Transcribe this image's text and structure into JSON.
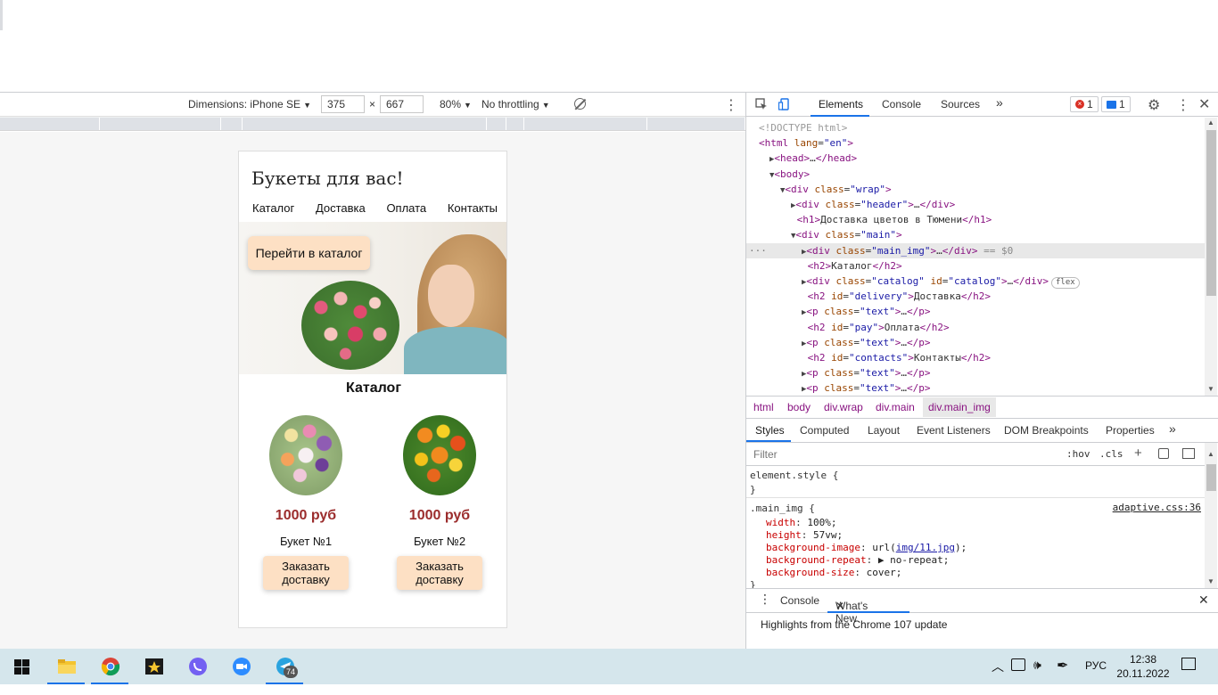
{
  "device_toolbar": {
    "dimensions_label": "Dimensions: iPhone SE",
    "width": "375",
    "times": "×",
    "height": "667",
    "zoom": "80%",
    "throttling": "No throttling"
  },
  "site": {
    "title": "Букеты для вас!",
    "nav": [
      "Каталог",
      "Доставка",
      "Оплата",
      "Контакты"
    ],
    "hero_button": "Перейти в каталог",
    "catalog_heading": "Каталог",
    "products": [
      {
        "price": "1000 руб",
        "name": "Букет №1",
        "button": "Заказать доставку"
      },
      {
        "price": "1000 руб",
        "name": "Букет №2",
        "button": "Заказать доставку"
      }
    ]
  },
  "devtools": {
    "tabs": [
      "Elements",
      "Console",
      "Sources"
    ],
    "more": "»",
    "error_count": "1",
    "message_count": "1",
    "dom_lines": [
      {
        "indent": 0,
        "html": "<span class='comment'>&lt;!DOCTYPE html&gt;</span>"
      },
      {
        "indent": 0,
        "html": "<span class='tag'>&lt;html</span> <span class='attr'>lang</span>=<span class='val'>\"en\"</span><span class='tag'>&gt;</span>"
      },
      {
        "indent": 1,
        "html": "<span class='tri'>▶</span><span class='tag'>&lt;head&gt;</span>…<span class='tag'>&lt;/head&gt;</span>"
      },
      {
        "indent": 1,
        "html": "<span class='tri'>▼</span><span class='tag'>&lt;body&gt;</span>"
      },
      {
        "indent": 2,
        "html": "<span class='tri'>▼</span><span class='tag'>&lt;div</span> <span class='attr'>class</span>=<span class='val'>\"wrap\"</span><span class='tag'>&gt;</span>"
      },
      {
        "indent": 3,
        "html": "<span class='tri'>▶</span><span class='tag'>&lt;div</span> <span class='attr'>class</span>=<span class='val'>\"header\"</span><span class='tag'>&gt;</span>…<span class='tag'>&lt;/div&gt;</span>"
      },
      {
        "indent": 3,
        "html": " <span class='tag'>&lt;h1&gt;</span>Доставка цветов в Тюмени<span class='tag'>&lt;/h1&gt;</span>"
      },
      {
        "indent": 3,
        "html": "<span class='tri'>▼</span><span class='tag'>&lt;div</span> <span class='attr'>class</span>=<span class='val'>\"main\"</span><span class='tag'>&gt;</span>"
      },
      {
        "indent": 4,
        "html": "<span class='tri'>▶</span><span class='tag'>&lt;div</span> <span class='attr'>class</span>=<span class='val'>\"main_img\"</span><span class='tag'>&gt;</span>…<span class='tag'>&lt;/div&gt;</span> <span class='eq0'>== $0</span>",
        "selected": true
      },
      {
        "indent": 4,
        "html": " <span class='tag'>&lt;h2&gt;</span>Каталог<span class='tag'>&lt;/h2&gt;</span>"
      },
      {
        "indent": 4,
        "html": "<span class='tri'>▶</span><span class='tag'>&lt;div</span> <span class='attr'>class</span>=<span class='val'>\"catalog\"</span> <span class='attr'>id</span>=<span class='val'>\"catalog\"</span><span class='tag'>&gt;</span>…<span class='tag'>&lt;/div&gt;</span><span class='flexbadge'>flex</span>"
      },
      {
        "indent": 4,
        "html": " <span class='tag'>&lt;h2</span> <span class='attr'>id</span>=<span class='val'>\"delivery\"</span><span class='tag'>&gt;</span>Доставка<span class='tag'>&lt;/h2&gt;</span>"
      },
      {
        "indent": 4,
        "html": "<span class='tri'>▶</span><span class='tag'>&lt;p</span> <span class='attr'>class</span>=<span class='val'>\"text\"</span><span class='tag'>&gt;</span>…<span class='tag'>&lt;/p&gt;</span>"
      },
      {
        "indent": 4,
        "html": " <span class='tag'>&lt;h2</span> <span class='attr'>id</span>=<span class='val'>\"pay\"</span><span class='tag'>&gt;</span>Оплата<span class='tag'>&lt;/h2&gt;</span>"
      },
      {
        "indent": 4,
        "html": "<span class='tri'>▶</span><span class='tag'>&lt;p</span> <span class='attr'>class</span>=<span class='val'>\"text\"</span><span class='tag'>&gt;</span>…<span class='tag'>&lt;/p&gt;</span>"
      },
      {
        "indent": 4,
        "html": " <span class='tag'>&lt;h2</span> <span class='attr'>id</span>=<span class='val'>\"contacts\"</span><span class='tag'>&gt;</span>Контакты<span class='tag'>&lt;/h2&gt;</span>"
      },
      {
        "indent": 4,
        "html": "<span class='tri'>▶</span><span class='tag'>&lt;p</span> <span class='attr'>class</span>=<span class='val'>\"text\"</span><span class='tag'>&gt;</span>…<span class='tag'>&lt;/p&gt;</span>"
      },
      {
        "indent": 4,
        "html": "<span class='tri'>▶</span><span class='tag'>&lt;p</span> <span class='attr'>class</span>=<span class='val'>\"text\"</span><span class='tag'>&gt;</span>…<span class='tag'>&lt;/p&gt;</span>"
      }
    ],
    "breadcrumbs": [
      "html",
      "body",
      "div.wrap",
      "div.main",
      "div.main_img"
    ],
    "sub_tabs": [
      "Styles",
      "Computed",
      "Layout",
      "Event Listeners",
      "DOM Breakpoints",
      "Properties"
    ],
    "filter_placeholder": "Filter",
    "hov": ":hov",
    "cls": ".cls",
    "element_style": "element.style {",
    "close_brace": "}",
    "rule_selector": ".main_img {",
    "rule_source": "adaptive.css:36",
    "rule_props": [
      {
        "name": "width",
        "value": "100%;"
      },
      {
        "name": "height",
        "value": "57vw;"
      },
      {
        "name": "background-image",
        "value": "url(",
        "link": "img/11.jpg",
        "tail": ");"
      },
      {
        "name": "background-repeat",
        "value": "▶ no-repeat;"
      },
      {
        "name": "background-size",
        "value": "cover;"
      }
    ],
    "drawer_tabs": [
      "Console",
      "What's New"
    ],
    "drawer_text": "Highlights from the Chrome 107 update"
  },
  "taskbar": {
    "telegram_badge": "74",
    "lang": "РУС",
    "time": "12:38",
    "date": "20.11.2022"
  }
}
